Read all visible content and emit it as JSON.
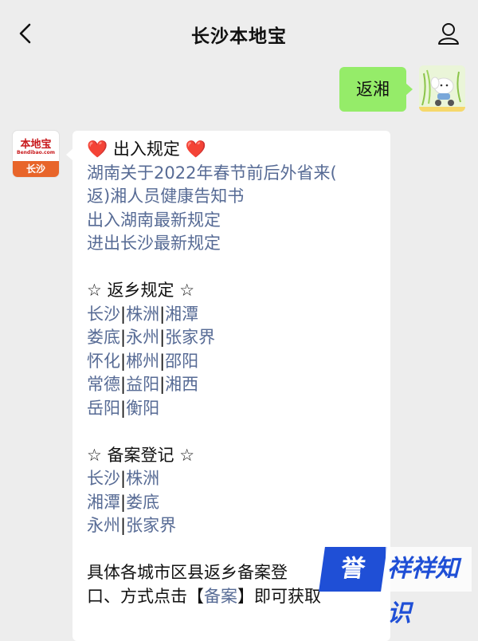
{
  "header": {
    "title": "长沙本地宝"
  },
  "sent_message": {
    "text": "返湘"
  },
  "bot_avatar": {
    "logo_text": "本地宝",
    "domain_text": "Bendibao.com",
    "city_label": "长沙"
  },
  "message": {
    "section1": {
      "title": "出入规定",
      "links": [
        "湖南关于2022年春节前后外省来(",
        "返)湘人员健康告知书",
        "出入湖南最新规定",
        "进出长沙最新规定"
      ]
    },
    "section2": {
      "title": "返乡规定",
      "rows": [
        [
          "长沙",
          "株洲",
          "湘潭"
        ],
        [
          "娄底",
          "永州",
          "张家界"
        ],
        [
          "怀化",
          "郴州",
          "邵阳"
        ],
        [
          "常德",
          "益阳",
          "湘西"
        ],
        [
          "岳阳",
          "衡阳"
        ]
      ]
    },
    "section3": {
      "title": "备案登记",
      "rows": [
        [
          "长沙",
          "株洲"
        ],
        [
          "湘潭",
          "娄底"
        ],
        [
          "永州",
          "张家界"
        ]
      ]
    },
    "footer": {
      "line1": "具体各城市区县返乡备案登",
      "line2_prefix": "口、方式点击【",
      "line2_link": "备案",
      "line2_suffix": "】即可获取"
    }
  },
  "watermark": {
    "badge": "誉",
    "text": "祥祥知识"
  },
  "colors": {
    "link": "#576b95",
    "sent_bubble": "#95ec69",
    "background": "#ededed",
    "heart": "#e0262b"
  }
}
